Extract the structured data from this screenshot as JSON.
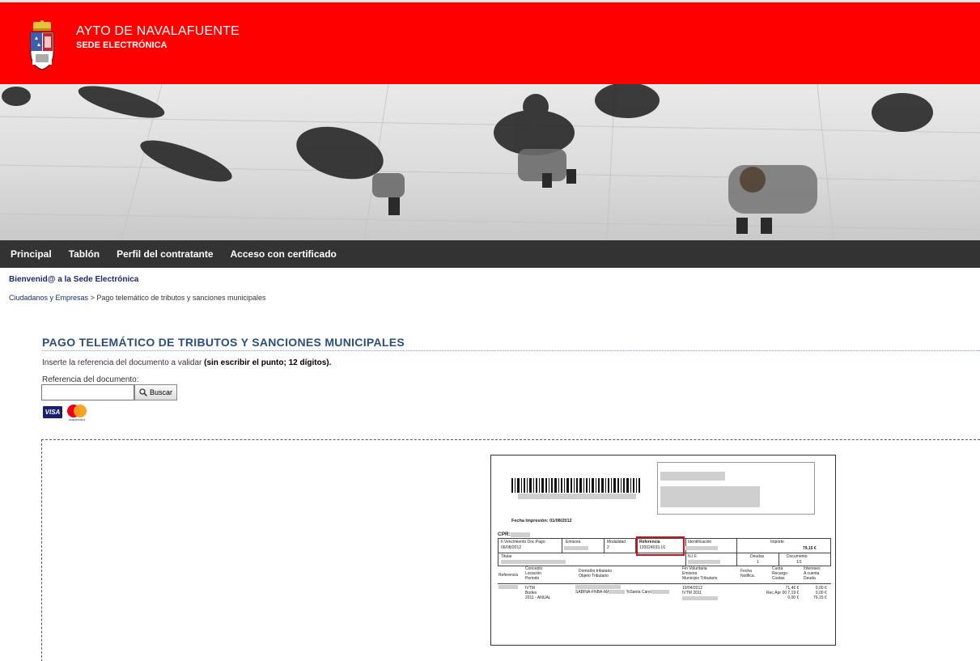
{
  "header": {
    "title": "AYTO DE NAVALAFUENTE",
    "subtitle": "SEDE ELECTRÓNICA",
    "crest_icon": "municipal-crest-icon",
    "bg_color": "#ff0000"
  },
  "nav": {
    "items": [
      "Principal",
      "Tablón",
      "Perfil del contratante",
      "Acceso con certificado"
    ],
    "bg_color": "#333333"
  },
  "welcome": "Bienvenid@ a la Sede Electrónica",
  "breadcrumb": {
    "link": "Ciudadanos y Empresas",
    "separator": ">",
    "current": "Pago telemático de tributos y sanciones municipales"
  },
  "main": {
    "title": "PAGO TELEMÁTICO DE TRIBUTOS Y SANCIONES MUNICIPALES",
    "instruction_text": "Inserte la referencia del documento a validar ",
    "instruction_bold": "(sin escribir el punto; 12 dígitos).",
    "ref_label": "Referencia del documento:",
    "ref_value": "",
    "search_label": "Buscar",
    "card_visa": "VISA",
    "card_mc": "mastercard"
  },
  "sample_doc": {
    "fecha": "Fecha Impresión: 01/08/2012",
    "cpr": "CPR:",
    "row1": {
      "vencimiento_label": "F.Vencimiento Doc.Pago",
      "vencimiento_value": "06/08/2012",
      "emisora_label": "Emisora",
      "modalidad_label": "Modalidad",
      "modalidad_value": "2",
      "referencia_label": "Referencia",
      "referencia_value": "120024033.16",
      "identificacion_label": "Identificación",
      "importe_label": "Importe",
      "importe_value": "79,15 €"
    },
    "row2": {
      "titular_label": "Titular",
      "nif_label": "N.I.F.",
      "deudas_label": "Deudas",
      "deudas_value": "1",
      "documento_label": "Documento",
      "documento_value": "1/1"
    },
    "head": {
      "referencia": "Referencia",
      "concepto": "Concepto\nLocación\nPeriodo",
      "domicilio": "Domicilio tributario\nObjeto Tributario",
      "fin": "Fin Voluntaria\nEmisora\nMunicipio Tributario",
      "fecha": "Fecha\nNotifica.",
      "cuota": "Cuota\nRecargo\nCostas",
      "intereses": "Intereses\nA cuenta\nDeuda"
    },
    "line": {
      "c1": "IVTM\nBodes\n2011 - ANUAL",
      "c2": "SABINA-FNBA-MAT:",
      "c2b": "%Santa Canos.l.",
      "c3": "10/04/2012\nIVTM 2011",
      "c4": "71,4€ €\nRec.Apr 00 7,19 €\n0,00 €",
      "c5": "0,00 €\n0,00 €\n79,15 €"
    }
  }
}
